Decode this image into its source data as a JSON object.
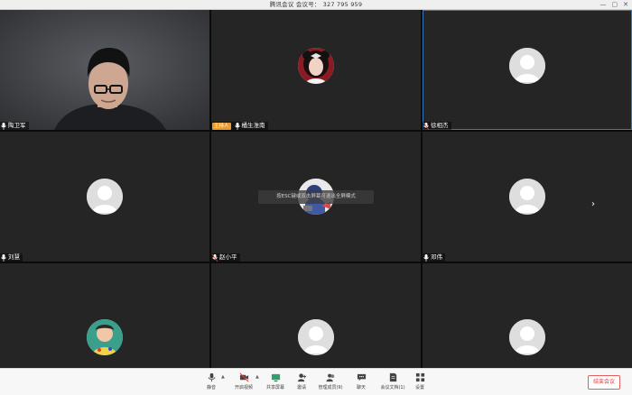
{
  "window": {
    "title": "腾讯会议 会议号：",
    "meeting_id": "327 795 959",
    "controls": [
      "—",
      "▢",
      "✕"
    ]
  },
  "participants": [
    {
      "name": "陶卫军",
      "video": true,
      "host": false
    },
    {
      "name": "橘生淮南",
      "video": false,
      "host": true,
      "host_label": "主持人"
    },
    {
      "name": "徐相杰",
      "video": false,
      "host": false
    },
    {
      "name": "刘慧",
      "video": false,
      "host": false
    },
    {
      "name": "赵小平",
      "video": false,
      "host": false
    },
    {
      "name": "邓伟",
      "video": false,
      "host": false
    },
    {
      "name": "",
      "video": false,
      "host": false
    },
    {
      "name": "",
      "video": false,
      "host": false
    },
    {
      "name": "",
      "video": false,
      "host": false
    }
  ],
  "toast": "按ESC键或双击屏幕可退出全屏模式",
  "toolbar": {
    "mute": "静音",
    "video": "开启视频",
    "share": "共享屏幕",
    "invite": "邀请",
    "members": "管理成员(9)",
    "chat": "聊天",
    "docs": "会议文档(1)",
    "settings": "设置",
    "end": "结束会议"
  },
  "colors": {
    "tile_bg": "#252525",
    "host_badge": "#e89a2a",
    "end_red": "#e04040",
    "active_border": "#3a78c2"
  }
}
